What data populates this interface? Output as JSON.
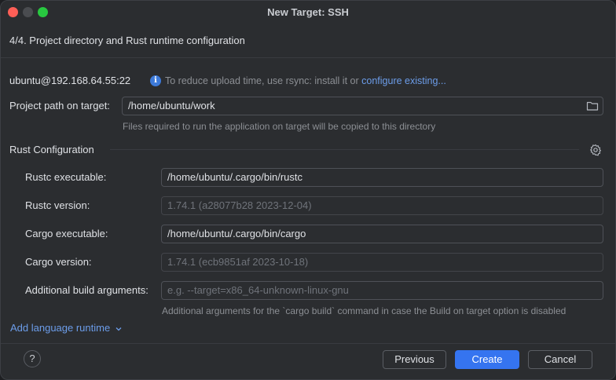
{
  "window": {
    "title": "New Target: SSH"
  },
  "header": {
    "step": "4/4. Project directory and Rust runtime configuration"
  },
  "connection": {
    "host": "ubuntu@192.168.64.55:22",
    "info_text": "To reduce upload time, use rsync: install it or",
    "info_link": "configure existing..."
  },
  "project": {
    "path_label": "Project path on target:",
    "path_value": "/home/ubuntu/work",
    "path_hint": "Files required to run the application on target will be copied to this directory"
  },
  "rust": {
    "section_title": "Rust Configuration",
    "rustc_exe_label": "Rustc executable:",
    "rustc_exe_value": "/home/ubuntu/.cargo/bin/rustc",
    "rustc_version_label": "Rustc version:",
    "rustc_version_value": "1.74.1 (a28077b28 2023-12-04)",
    "cargo_exe_label": "Cargo executable:",
    "cargo_exe_value": "/home/ubuntu/.cargo/bin/cargo",
    "cargo_version_label": "Cargo version:",
    "cargo_version_value": "1.74.1 (ecb9851af 2023-10-18)",
    "build_args_label": "Additional build arguments:",
    "build_args_placeholder": "e.g. --target=x86_64-unknown-linux-gnu",
    "build_args_hint": "Additional arguments for the `cargo build` command in case the Build on target  option is disabled"
  },
  "add_runtime": {
    "label": "Add language runtime"
  },
  "footer": {
    "help": "?",
    "previous": "Previous",
    "create": "Create",
    "cancel": "Cancel"
  },
  "colors": {
    "accent": "#3574f0",
    "link": "#6c9dea",
    "background": "#2b2d30"
  },
  "icons": [
    "info-icon",
    "folder-icon",
    "gear-icon",
    "chevron-down-icon",
    "help-icon"
  ]
}
